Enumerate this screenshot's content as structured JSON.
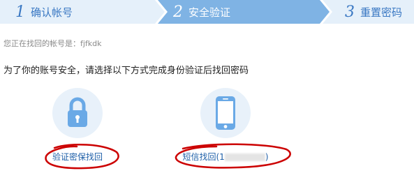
{
  "steps": [
    {
      "number": "1",
      "label": "确认帐号",
      "state": "done"
    },
    {
      "number": "2",
      "label": "安全验证",
      "state": "active"
    },
    {
      "number": "3",
      "label": "重置密码",
      "state": "pending"
    }
  ],
  "account": {
    "prefix": "您正在找回的帐号是：",
    "name": "fjfkdk"
  },
  "instruction": "为了你的账号安全，请选择以下方式完成身份验证后找回密码",
  "methods": {
    "security_question": {
      "icon": "lock-icon",
      "label": "验证密保找回"
    },
    "sms": {
      "icon": "phone-icon",
      "label": "短信找回(1",
      "masked_suffix": "",
      "closing": ")"
    }
  },
  "colors": {
    "step_bg": "#e5f0fa",
    "step_active_bg": "#7fb3e4",
    "accent_text": "#3a78c3",
    "icon_blue": "#6aa9e6",
    "icon_circle": "#e8f1fa",
    "link": "#1e5fa8",
    "annotation_red": "#cc0000"
  }
}
